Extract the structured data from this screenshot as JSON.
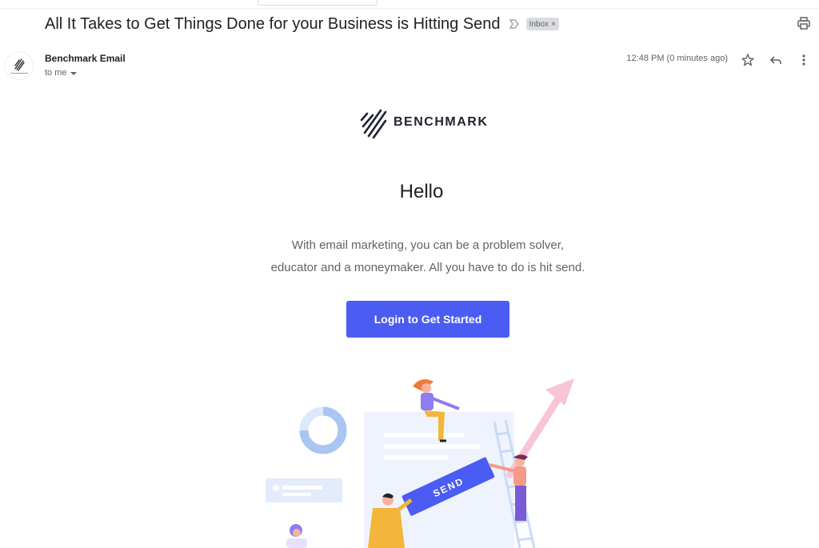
{
  "email": {
    "subject": "All It Takes to Get Things Done for your Business is Hitting Send",
    "label": "Inbox",
    "label_remove": "×",
    "sender_name": "Benchmark Email",
    "recipient": "to me",
    "timestamp": "12:48 PM (0 minutes ago)"
  },
  "body": {
    "brand_name": "BENCHMARK",
    "greeting": "Hello",
    "line1": "With email marketing, you can be a problem solver,",
    "line2": "educator and a moneymaker. All you have to do is hit send.",
    "cta_label": "Login to Get Started",
    "illustration_text": "SEND"
  },
  "icons": {
    "important": "important-marker-icon",
    "print": "print-icon",
    "star": "star-icon",
    "reply": "reply-icon",
    "more": "more-vert-icon"
  },
  "colors": {
    "cta": "#4b5cf2",
    "brand": "#1f2330",
    "label_chip": "#dadce0"
  }
}
